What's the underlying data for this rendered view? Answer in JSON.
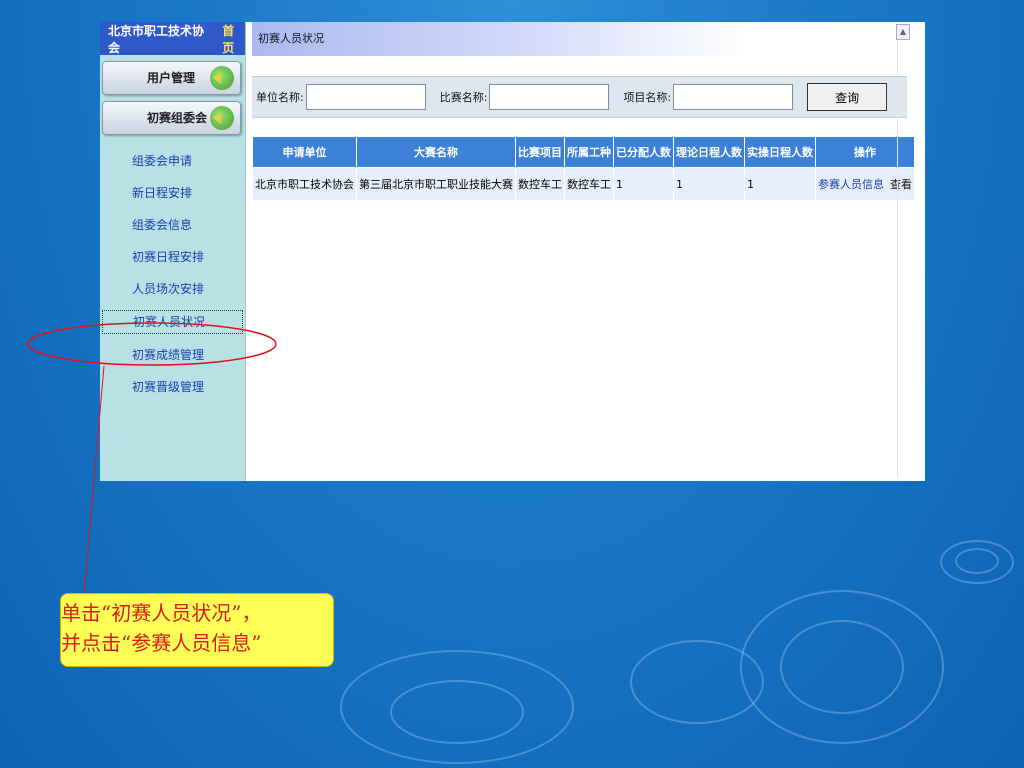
{
  "sidebar": {
    "org_name": "北京市职工技术协会",
    "home": "首页",
    "buttons": [
      {
        "label": "用户管理"
      },
      {
        "label": "初赛组委会"
      }
    ],
    "menu": [
      {
        "label": "组委会申请"
      },
      {
        "label": "新日程安排"
      },
      {
        "label": "组委会信息"
      },
      {
        "label": "初赛日程安排"
      },
      {
        "label": "人员场次安排"
      },
      {
        "label": "初赛人员状况"
      },
      {
        "label": "初赛成绩管理"
      },
      {
        "label": "初赛晋级管理"
      }
    ]
  },
  "content": {
    "title": "初赛人员状况",
    "search": {
      "unit_label": "单位名称:",
      "contest_label": "比赛名称:",
      "project_label": "项目名称:",
      "query_button": "查询"
    },
    "table": {
      "headers": [
        "申请单位",
        "大赛名称",
        "比赛项目",
        "所属工种",
        "已分配人数",
        "理论日程人数",
        "实操日程人数",
        "操作"
      ],
      "rows": [
        {
          "unit": "北京市职工技术协会",
          "contest": "第三届北京市职工职业技能大赛",
          "project": "数控车工",
          "trade": "数控车工",
          "assigned": "1",
          "theory": "1",
          "practice": "1",
          "action_info": "参赛人员信息",
          "action_view": "查看"
        }
      ]
    }
  },
  "callout": {
    "line1": "单击“初赛人员状况”，",
    "line2": "并点击“参赛人员信息”"
  },
  "colors": {
    "accent": "#3d80d8",
    "highlight_ellipse": "#e0141e",
    "callout_bg": "#ffff55"
  }
}
